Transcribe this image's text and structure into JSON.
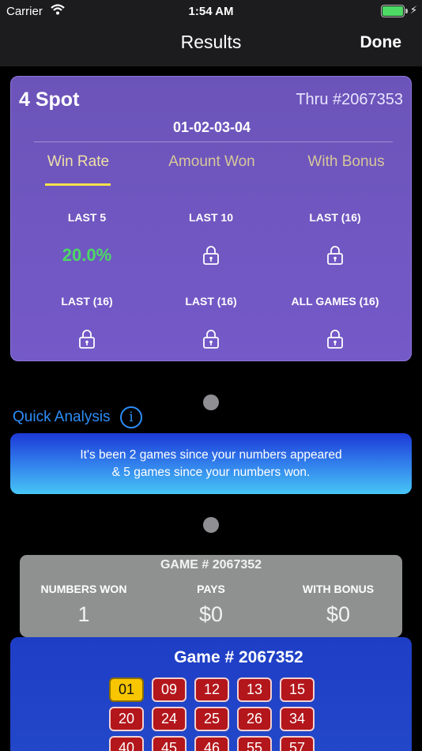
{
  "status_bar": {
    "carrier": "Carrier",
    "time": "1:54 AM"
  },
  "nav": {
    "title": "Results",
    "done_label": "Done"
  },
  "card": {
    "title": "4 Spot",
    "thru": "Thru #2067353",
    "numbers": "01-02-03-04",
    "tabs": [
      "Win Rate",
      "Amount Won",
      "With Bonus"
    ],
    "active_tab": "Win Rate",
    "cells": [
      {
        "label": "LAST 5",
        "value": "20.0%",
        "locked": false
      },
      {
        "label": "LAST 10",
        "locked": true
      },
      {
        "label": "LAST (16)",
        "locked": true
      },
      {
        "label": "LAST (16)",
        "locked": true
      },
      {
        "label": "LAST (16)",
        "locked": true
      },
      {
        "label": "ALL GAMES (16)",
        "locked": true
      }
    ]
  },
  "quick_analysis": {
    "title": "Quick Analysis",
    "info_glyph": "i",
    "line1": "It's been 2 games since your numbers appeared",
    "line2": "& 5 games since your numbers won."
  },
  "summary": {
    "title": "GAME # 2067352",
    "columns": [
      {
        "label": "NUMBERS WON",
        "value": "1"
      },
      {
        "label": "PAYS",
        "value": "$0"
      },
      {
        "label": "WITH BONUS",
        "value": "$0"
      }
    ]
  },
  "game_panel": {
    "title": "Game # 2067352",
    "balls": [
      {
        "n": "01",
        "hit": true
      },
      {
        "n": "09",
        "hit": false
      },
      {
        "n": "12",
        "hit": false
      },
      {
        "n": "13",
        "hit": false
      },
      {
        "n": "15",
        "hit": false
      },
      {
        "n": "20",
        "hit": false
      },
      {
        "n": "24",
        "hit": false
      },
      {
        "n": "25",
        "hit": false
      },
      {
        "n": "26",
        "hit": false
      },
      {
        "n": "34",
        "hit": false
      },
      {
        "n": "40",
        "hit": false
      },
      {
        "n": "45",
        "hit": false
      },
      {
        "n": "46",
        "hit": false
      },
      {
        "n": "55",
        "hit": false
      },
      {
        "n": "57",
        "hit": false
      }
    ]
  },
  "colors": {
    "card": "#7459c8",
    "win_green": "#4cd964",
    "accent_blue": "#2d8df8",
    "ball_red": "#b3161b",
    "ball_hit": "#f7c600"
  }
}
